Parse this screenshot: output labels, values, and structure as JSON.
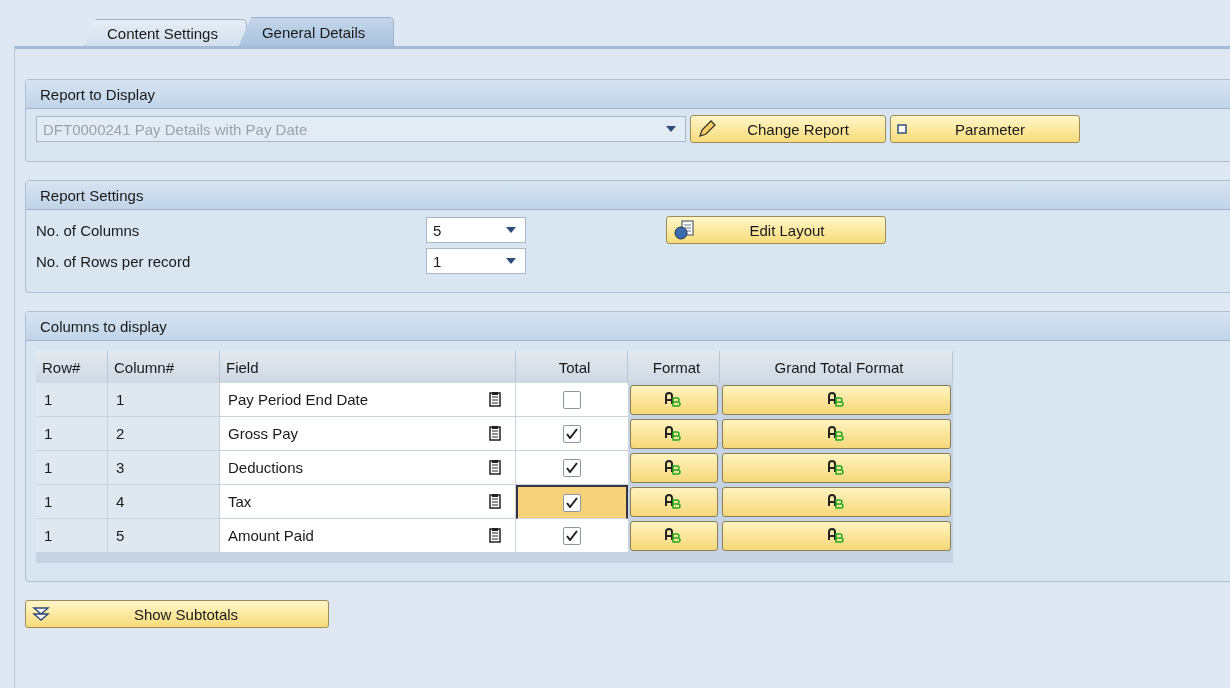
{
  "tabs": [
    {
      "label": "Content Settings",
      "selected": false
    },
    {
      "label": "General Details",
      "selected": true
    }
  ],
  "report_to_display": {
    "title": "Report to Display",
    "report": "DFT0000241 Pay Details with Pay Date",
    "disabled": true,
    "buttons": [
      {
        "label": "Change Report",
        "kind": "pencil"
      },
      {
        "label": "Parameter",
        "kind": "square"
      }
    ]
  },
  "report_settings": {
    "title": "Report Settings",
    "fields": [
      {
        "label": "No. of Columns",
        "value": "5"
      },
      {
        "label": "No. of Rows per record",
        "value": "1"
      }
    ],
    "button": {
      "label": "Edit Layout",
      "kind": "layout"
    }
  },
  "columns_to_display": {
    "title": "Columns to display",
    "columns": [
      "Row#",
      "Column#",
      "Field",
      "Total",
      "Format",
      "Grand Total Format"
    ],
    "rows": [
      {
        "row": "1",
        "column": "1",
        "field": "Pay Period End Date",
        "total": false,
        "focused": false
      },
      {
        "row": "1",
        "column": "2",
        "field": "Gross Pay",
        "total": true,
        "focused": false
      },
      {
        "row": "1",
        "column": "3",
        "field": "Deductions",
        "total": true,
        "focused": false
      },
      {
        "row": "1",
        "column": "4",
        "field": "Tax",
        "total": true,
        "focused": true
      },
      {
        "row": "1",
        "column": "5",
        "field": "Amount Paid",
        "total": true,
        "focused": false
      }
    ]
  },
  "footer_button": {
    "label": "Show Subtotals",
    "kind": "subtotals"
  }
}
